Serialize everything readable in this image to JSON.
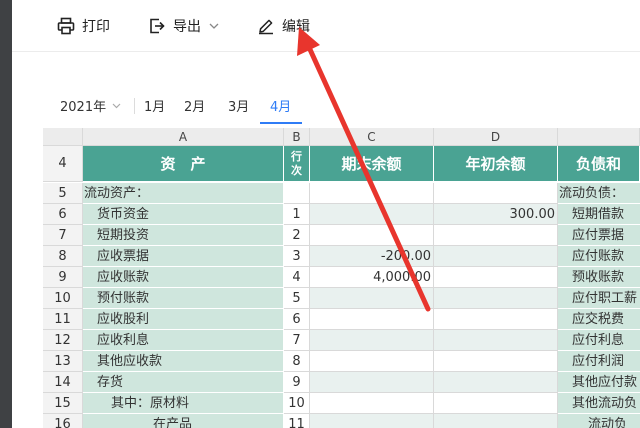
{
  "toolbar": {
    "print_label": "打印",
    "export_label": "导出",
    "edit_label": "编辑"
  },
  "filter": {
    "year": "2021年",
    "months": [
      "1月",
      "2月",
      "3月",
      "4月"
    ],
    "active_month": "4月"
  },
  "sheet": {
    "column_letters": [
      "A",
      "B",
      "C",
      "D",
      ""
    ],
    "header_row_number": "4",
    "headers": [
      "资　产",
      "行次",
      "期末余额",
      "年初余额",
      "负债和"
    ],
    "rows": [
      {
        "num": "5",
        "asset": "流动资产：",
        "line": "",
        "end": "",
        "start": "",
        "liab": "流动负债："
      },
      {
        "num": "6",
        "asset": "货币资金",
        "line": "1",
        "end": "",
        "start": "300.00",
        "liab": "短期借款"
      },
      {
        "num": "7",
        "asset": "短期投资",
        "line": "2",
        "end": "",
        "start": "",
        "liab": "应付票据"
      },
      {
        "num": "8",
        "asset": "应收票据",
        "line": "3",
        "end": "-200.00",
        "start": "",
        "liab": "应付账款"
      },
      {
        "num": "9",
        "asset": "应收账款",
        "line": "4",
        "end": "4,000.00",
        "start": "",
        "liab": "预收账款"
      },
      {
        "num": "10",
        "asset": "预付账款",
        "line": "5",
        "end": "",
        "start": "",
        "liab": "应付职工薪"
      },
      {
        "num": "11",
        "asset": "应收股利",
        "line": "6",
        "end": "",
        "start": "",
        "liab": "应交税费"
      },
      {
        "num": "12",
        "asset": "应收利息",
        "line": "7",
        "end": "",
        "start": "",
        "liab": "应付利息"
      },
      {
        "num": "13",
        "asset": "其他应收款",
        "line": "8",
        "end": "",
        "start": "",
        "liab": "应付利润"
      },
      {
        "num": "14",
        "asset": "存货",
        "line": "9",
        "end": "",
        "start": "",
        "liab": "其他应付款"
      },
      {
        "num": "15",
        "asset": "其中：原材料",
        "line": "10",
        "end": "",
        "start": "",
        "liab": "其他流动负"
      },
      {
        "num": "16",
        "asset": "在产品",
        "line": "11",
        "end": "",
        "start": "",
        "liab": "流动负"
      }
    ]
  },
  "colors": {
    "header_teal": "#4aa393",
    "asset_cell_green": "#cfe6dd",
    "data_cell_light": "#e9f1ef",
    "grid_gray": "#e6e6e6",
    "accent_blue": "#2f7cf6",
    "arrow_red": "#e8352d"
  }
}
